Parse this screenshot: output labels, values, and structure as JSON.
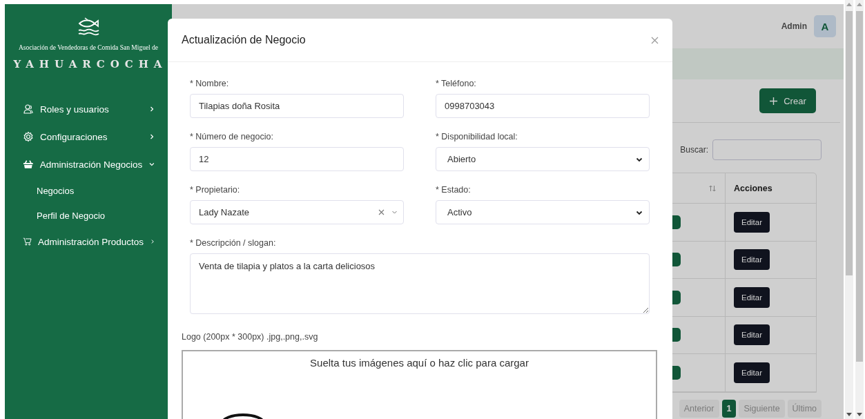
{
  "sidebar": {
    "logo_caption": "Asociación de Vendedoras de Comida San Miguel de",
    "logo_title": "YAHUARCOCHA",
    "items": [
      {
        "label": "Roles y usuarios",
        "expanded": false
      },
      {
        "label": "Configuraciones",
        "expanded": false
      },
      {
        "label": "Administración Negocios",
        "expanded": true,
        "children": [
          {
            "label": "Negocios"
          },
          {
            "label": "Perfil de Negocio"
          }
        ]
      },
      {
        "label": "Administración Productos",
        "expanded": false
      }
    ]
  },
  "header": {
    "user": "Admin",
    "avatar": "A"
  },
  "card": {
    "create_button": "Crear",
    "search_label": "Buscar:",
    "table": {
      "columns": [
        {
          "sortable": true
        },
        {
          "label": "Acciones",
          "sortable": false
        }
      ],
      "rows": [
        {
          "action": "Editar"
        },
        {
          "action": "Editar"
        },
        {
          "action": "Editar"
        },
        {
          "action": "Editar"
        },
        {
          "action": "Editar"
        }
      ]
    },
    "pagination": [
      {
        "label": "Anterior",
        "selected": false
      },
      {
        "label": "1",
        "selected": true
      },
      {
        "label": "Siguiente",
        "selected": false
      },
      {
        "label": "Último",
        "selected": false
      }
    ]
  },
  "modal": {
    "title": "Actualización de Negocio",
    "fields": [
      {
        "kind": "input",
        "label": "* Nombre:",
        "value": "Tilapias doña Rosita"
      },
      {
        "kind": "input",
        "label": "* Teléfono:",
        "value": "0998703043"
      },
      {
        "kind": "input",
        "label": "* Número de negocio:",
        "value": "12"
      },
      {
        "kind": "select",
        "label": "* Disponibilidad local:",
        "value": "Abierto"
      },
      {
        "kind": "combobox",
        "label": "* Propietario:",
        "value": "Lady Nazate"
      },
      {
        "kind": "select",
        "label": "* Estado:",
        "value": "Activo"
      },
      {
        "kind": "textarea",
        "label": "* Descripción / slogan:",
        "value": "Venta de tilapia y platos a la carta deliciosos"
      }
    ],
    "logo_label": "Logo (200px * 300px) .jpg,.png,.svg",
    "dropzone_text": "Suelta tus imágenes aquí o haz clic para cargar"
  }
}
